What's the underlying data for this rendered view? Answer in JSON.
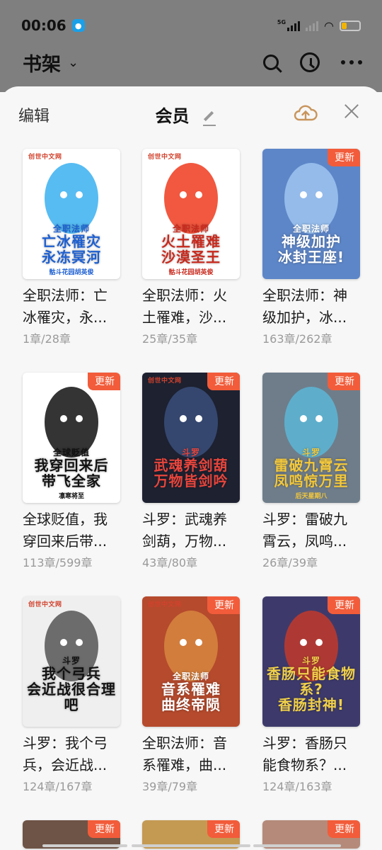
{
  "status": {
    "time": "00:06",
    "network": "5G",
    "app_icon": "qq-icon"
  },
  "shelf": {
    "title": "书架",
    "icons": [
      "search-icon",
      "history-icon",
      "more-icon"
    ]
  },
  "sheet": {
    "edit_label": "编辑",
    "title": "会员",
    "icons": [
      "pencil-icon",
      "cloud-upload-icon",
      "close-icon"
    ]
  },
  "colors": {
    "badge": "#f25c3a",
    "accent_cloud": "#c8955c",
    "dim_overlay": "#7f7f7f"
  },
  "books": [
    {
      "title": "全职法师：亡冰罹灾，永...",
      "progress": "1章/28章",
      "updated": false,
      "cover": {
        "brand": "创世中文网",
        "line1": "全职法师",
        "line2": "亡冰罹灾",
        "line3": "永冻冥河",
        "sub": "骷斗花园胡英俊",
        "bg": "#ffffff",
        "fg": "#1d5fd1",
        "art": "#3ab0f0"
      }
    },
    {
      "title": "全职法师：火土罹难，沙...",
      "progress": "25章/35章",
      "updated": false,
      "cover": {
        "brand": "创世中文网",
        "line1": "全职法师",
        "line2": "火土罹难",
        "line3": "沙漠圣王",
        "sub": "骷斗花园胡英俊",
        "bg": "#ffffff",
        "fg": "#c8281c",
        "art": "#ee3b1d"
      }
    },
    {
      "title": "全职法师：神级加护，冰...",
      "progress": "163章/262章",
      "updated": true,
      "cover": {
        "brand": "",
        "line1": "全职法师",
        "line2": "神级加护",
        "line3": "冰封王座!",
        "sub": "",
        "bg": "#5d86c8",
        "fg": "#ffffff",
        "art": "#9ec4f0"
      }
    },
    {
      "title": "全球贬值，我穿回来后带...",
      "progress": "113章/599章",
      "updated": true,
      "cover": {
        "brand": "",
        "line1": "全球贬值",
        "line2": "我穿回来后",
        "line3": "带飞全家",
        "sub": "凛寒将至",
        "bg": "#ffffff",
        "fg": "#111111",
        "art": "#111111"
      }
    },
    {
      "title": "斗罗：武魂养剑葫，万物...",
      "progress": "43章/80章",
      "updated": true,
      "cover": {
        "brand": "创世中文网",
        "line1": "斗罗",
        "line2": "武魂养剑葫",
        "line3": "万物皆剑吟",
        "sub": "",
        "bg": "#1d2130",
        "fg": "#e8453c",
        "art": "#3a4d7a"
      }
    },
    {
      "title": "斗罗：雷破九霄云，凤鸣...",
      "progress": "26章/39章",
      "updated": true,
      "cover": {
        "brand": "",
        "line1": "斗罗",
        "line2": "雷破九霄云",
        "line3": "凤鸣惊万里",
        "sub": "后天星期八",
        "bg": "#6f7d8a",
        "fg": "#f4c83a",
        "art": "#5cb6d6"
      }
    },
    {
      "title": "斗罗：我个弓兵，会近战...",
      "progress": "124章/167章",
      "updated": false,
      "cover": {
        "brand": "创世中文网",
        "line1": "斗罗",
        "line2": "我个弓兵",
        "line3": "会近战很合理吧",
        "sub": "",
        "bg": "#efefef",
        "fg": "#111111",
        "art": "#555555"
      }
    },
    {
      "title": "全职法师：音系罹难，曲...",
      "progress": "39章/79章",
      "updated": true,
      "cover": {
        "brand": "创世中文网",
        "line1": "全职法师",
        "line2": "音系罹难",
        "line3": "曲终帝陨",
        "sub": "",
        "bg": "#b54a2d",
        "fg": "#ffffff",
        "art": "#d7863f"
      }
    },
    {
      "title": "斗罗：香肠只能食物系？...",
      "progress": "124章/163章",
      "updated": true,
      "cover": {
        "brand": "",
        "line1": "斗罗",
        "line2": "香肠只能食物系?",
        "line3": "香肠封神!",
        "sub": "",
        "bg": "#3d3a6b",
        "fg": "#f0d04a",
        "art": "#c23a2a"
      }
    }
  ],
  "partial_row": {
    "updated_label": "更新"
  }
}
